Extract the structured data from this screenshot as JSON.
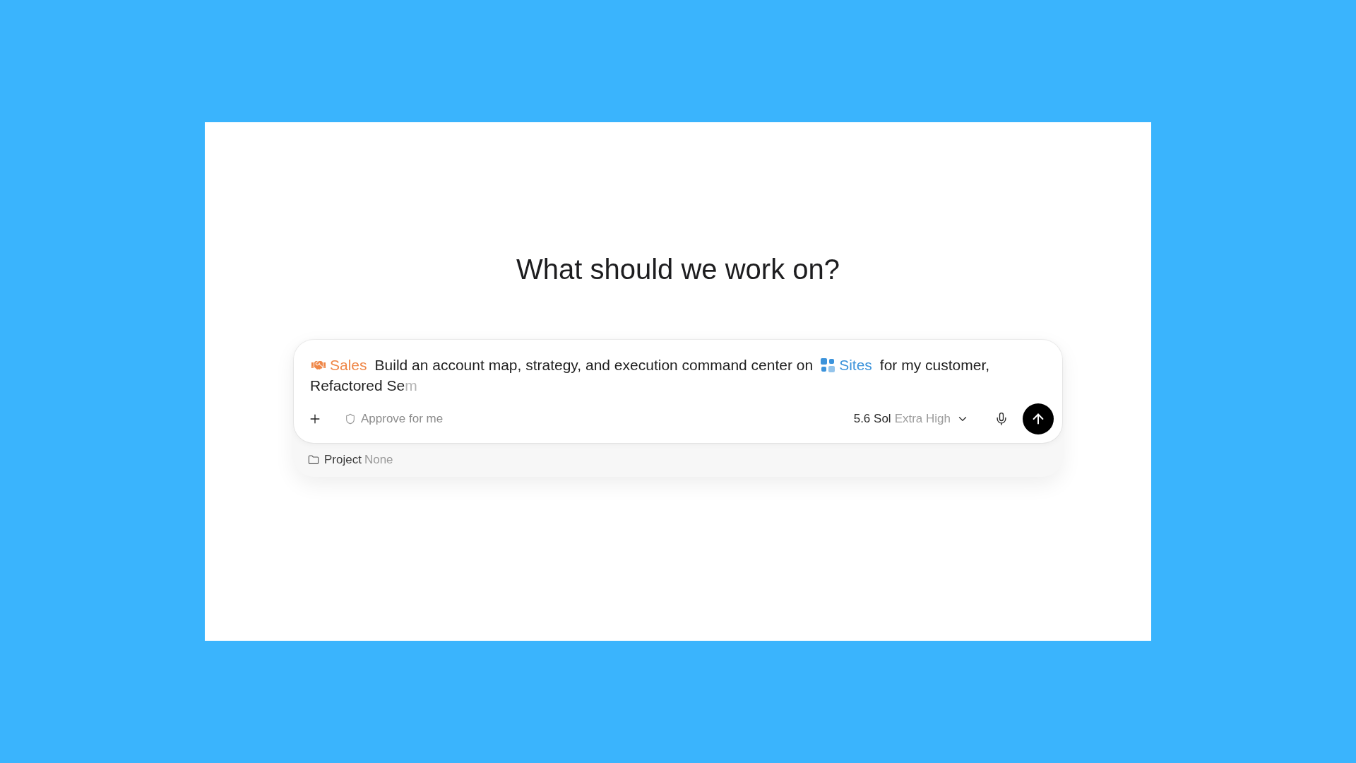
{
  "heading": "What should we work on?",
  "composer": {
    "prompt": [
      {
        "kind": "skill",
        "text": "Sales",
        "color": "#ef8748"
      },
      {
        "kind": "text",
        "text": "Build an account map, strategy, and execution command center on"
      },
      {
        "kind": "app",
        "text": "Sites",
        "color": "#3c93db"
      },
      {
        "kind": "text",
        "text": "for my customer,"
      },
      {
        "kind": "text",
        "text": "Refactored Se"
      },
      {
        "kind": "pending",
        "text": "m"
      }
    ],
    "approval": {
      "label": "Approve for me"
    },
    "model": {
      "name": "5.6 Sol",
      "effort": "Extra High"
    }
  },
  "project": {
    "label": "Project",
    "value": "None"
  }
}
